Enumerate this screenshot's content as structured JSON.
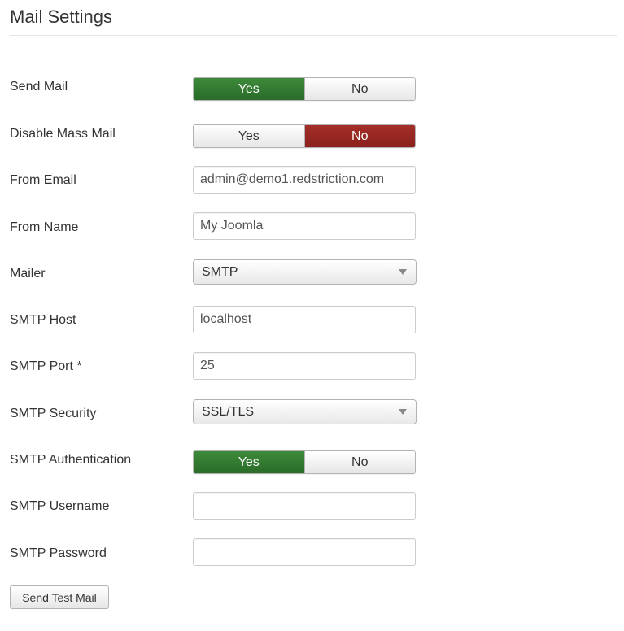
{
  "page": {
    "title": "Mail Settings"
  },
  "fields": {
    "send_mail": {
      "label": "Send Mail",
      "yes": "Yes",
      "no": "No",
      "selected": "Yes"
    },
    "disable_mass_mail": {
      "label": "Disable Mass Mail",
      "yes": "Yes",
      "no": "No",
      "selected": "No"
    },
    "from_email": {
      "label": "From Email",
      "value": "admin@demo1.redstriction.com"
    },
    "from_name": {
      "label": "From Name",
      "value": "My Joomla"
    },
    "mailer": {
      "label": "Mailer",
      "value": "SMTP"
    },
    "smtp_host": {
      "label": "SMTP Host",
      "value": "localhost"
    },
    "smtp_port": {
      "label": "SMTP Port *",
      "value": "25"
    },
    "smtp_security": {
      "label": "SMTP Security",
      "value": "SSL/TLS"
    },
    "smtp_auth": {
      "label": "SMTP Authentication",
      "yes": "Yes",
      "no": "No",
      "selected": "Yes"
    },
    "smtp_username": {
      "label": "SMTP Username",
      "value": ""
    },
    "smtp_password": {
      "label": "SMTP Password",
      "value": ""
    }
  },
  "actions": {
    "send_test_mail": "Send Test Mail"
  },
  "colors": {
    "toggle_yes_active": "#2f7a2d",
    "toggle_no_active": "#982824",
    "title_rule": "#e5e5e5"
  }
}
